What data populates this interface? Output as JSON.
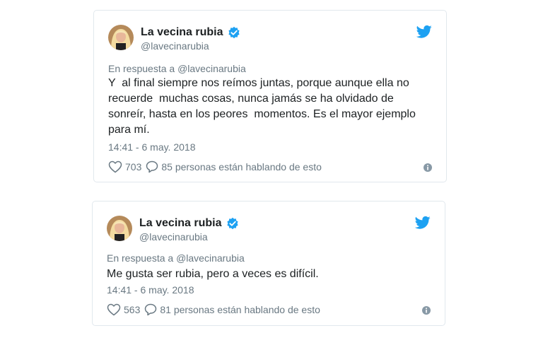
{
  "colors": {
    "brand": "#1da1f2",
    "verified": "#1da1f2",
    "secondary_text": "#697882",
    "border": "#e1e8ed"
  },
  "icons": {
    "logo": "twitter-bird-icon",
    "verified": "verified-badge-icon",
    "like": "heart-icon",
    "reply": "speech-bubble-icon",
    "info": "info-icon"
  },
  "tweets": [
    {
      "author": {
        "name": "La vecina rubia",
        "handle": "@lavecinarubia"
      },
      "reply_prefix": "En respuesta a ",
      "reply_to": "@lavecinarubia",
      "text": "Y  al final siempre nos reímos juntas, porque aunque ella no\nrecuerde  muchas cosas, nunca jamás se ha olvidado de\nsonreír, hasta en los peores  momentos. Es el mayor ejemplo\npara mí.",
      "timestamp": "14:41 - 6 may. 2018",
      "likes": "703",
      "talking": "85 personas están hablando de esto"
    },
    {
      "author": {
        "name": "La vecina rubia",
        "handle": "@lavecinarubia"
      },
      "reply_prefix": "En respuesta a ",
      "reply_to": "@lavecinarubia",
      "text": "Me gusta ser rubia, pero a veces es difícil.",
      "timestamp": "14:41 - 6 may. 2018",
      "likes": "563",
      "talking": "81 personas están hablando de esto"
    }
  ]
}
